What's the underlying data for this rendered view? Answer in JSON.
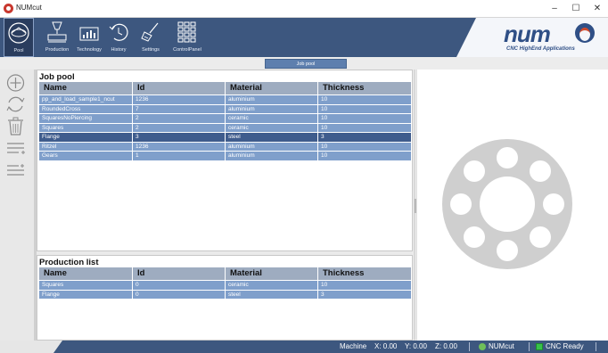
{
  "window": {
    "title": "NUMcut",
    "min": "–",
    "max": "☐",
    "close": "✕"
  },
  "nav": [
    {
      "label": "Pool",
      "icon": "pool-icon"
    },
    {
      "label": "Production",
      "icon": "production-icon"
    },
    {
      "label": "Technology",
      "icon": "technology-icon"
    },
    {
      "label": "History",
      "icon": "history-icon"
    },
    {
      "label": "Settings",
      "icon": "settings-icon"
    },
    {
      "label": "ControlPanel",
      "icon": "control-panel-icon"
    }
  ],
  "logo": {
    "brand": "num",
    "tagline": "CNC HighEnd Applications"
  },
  "tabs": {
    "active": "Job pool"
  },
  "job_pool": {
    "title": "Job pool",
    "columns": [
      "Name",
      "Id",
      "Material",
      "Thickness"
    ],
    "rows": [
      {
        "name": "pp_and_load_sample1_ncut",
        "id": "1236",
        "material": "aluminium",
        "thickness": "10"
      },
      {
        "name": "RoundedCross",
        "id": "7",
        "material": "aluminium",
        "thickness": "10"
      },
      {
        "name": "SquaresNoPiercing",
        "id": "2",
        "material": "ceramic",
        "thickness": "10"
      },
      {
        "name": "Squares",
        "id": "2",
        "material": "ceramic",
        "thickness": "10"
      },
      {
        "name": "Flange",
        "id": "3",
        "material": "steel",
        "thickness": "3"
      },
      {
        "name": "Ritzel",
        "id": "1236",
        "material": "aluminium",
        "thickness": "10"
      },
      {
        "name": "Gears",
        "id": "1",
        "material": "aluminium",
        "thickness": "10"
      }
    ],
    "selected_index": 4
  },
  "production_list": {
    "title": "Production list",
    "columns": [
      "Name",
      "Id",
      "Material",
      "Thickness"
    ],
    "rows": [
      {
        "name": "Squares",
        "id": "0",
        "material": "ceramic",
        "thickness": "10"
      },
      {
        "name": "Flange",
        "id": "0",
        "material": "steel",
        "thickness": "3"
      }
    ]
  },
  "status": {
    "machine_label": "Machine",
    "x": "X: 0.00",
    "y": "Y: 0.00",
    "z": "Z: 0.00",
    "app": "NUMcut",
    "cnc_state": "CNC Ready"
  },
  "colors": {
    "ribbon": "#3d577f",
    "row": "#7f9fcb",
    "row_selected": "#3f5c8d",
    "header": "#9eacc0",
    "preview_part": "#cfcfcf"
  }
}
